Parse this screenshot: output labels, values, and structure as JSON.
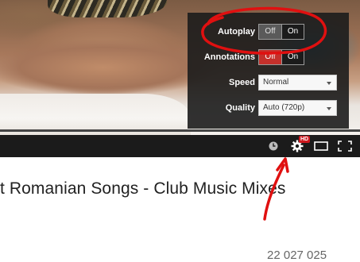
{
  "settings": {
    "autoplay": {
      "label": "Autoplay",
      "off": "Off",
      "on": "On",
      "state": "off"
    },
    "annotations": {
      "label": "Annotations",
      "off": "Off",
      "on": "On",
      "state": "off"
    },
    "speed": {
      "label": "Speed",
      "value": "Normal"
    },
    "quality": {
      "label": "Quality",
      "value": "Auto (720p)"
    }
  },
  "controls": {
    "hd_badge": "HD",
    "icons": [
      "clock-icon",
      "gear-icon",
      "theater-mode-icon",
      "fullscreen-icon"
    ]
  },
  "video": {
    "title": "t Romanian Songs - Club Music Mixes",
    "views": "22 027 025"
  },
  "colors": {
    "annotation_red": "#e01010",
    "off_active_red": "#c4302b",
    "panel_bg": "#1c1c1c"
  }
}
